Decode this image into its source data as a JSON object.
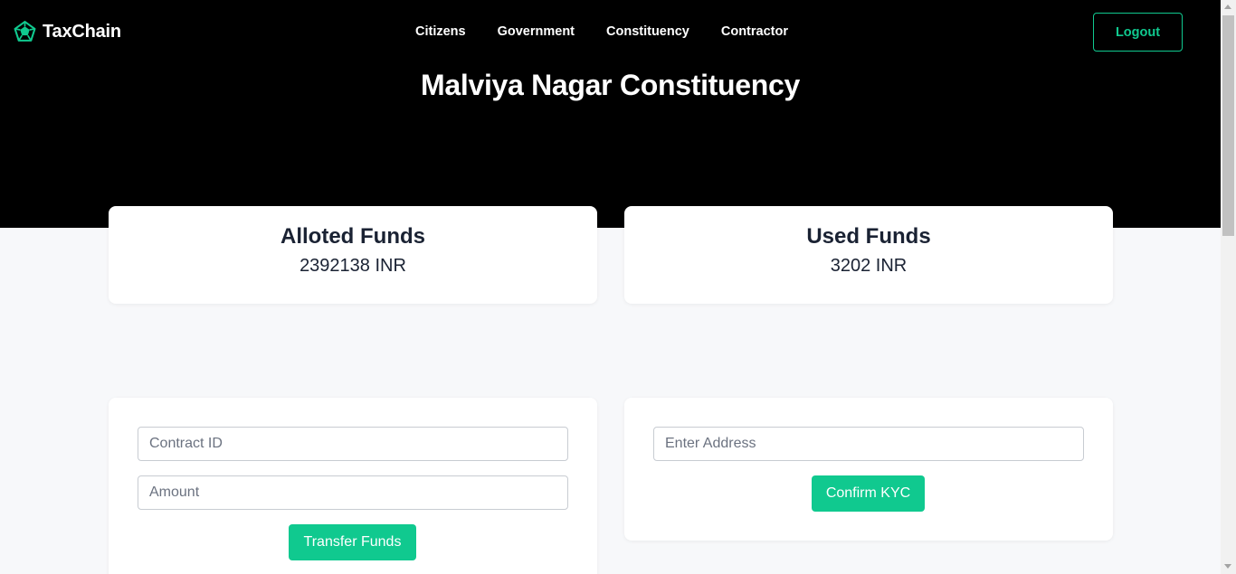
{
  "brand": {
    "name": "TaxChain",
    "icon": "dodecahedron-icon",
    "accent": "#10c98f"
  },
  "nav": {
    "links": [
      {
        "label": "Citizens"
      },
      {
        "label": "Government"
      },
      {
        "label": "Constituency"
      },
      {
        "label": "Contractor"
      }
    ],
    "logout_label": "Logout"
  },
  "page": {
    "title": "Malviya Nagar Constituency"
  },
  "stats": {
    "alloted": {
      "label": "Alloted Funds",
      "value": "2392138 INR"
    },
    "used": {
      "label": "Used Funds",
      "value": "3202 INR"
    }
  },
  "transfer_form": {
    "contract_id_placeholder": "Contract ID",
    "amount_placeholder": "Amount",
    "submit_label": "Transfer Funds"
  },
  "kyc_form": {
    "address_placeholder": "Enter Address",
    "submit_label": "Confirm KYC"
  },
  "colors": {
    "hero_bg": "#000000",
    "page_bg": "#f7f8fa",
    "button": "#10c98f"
  }
}
